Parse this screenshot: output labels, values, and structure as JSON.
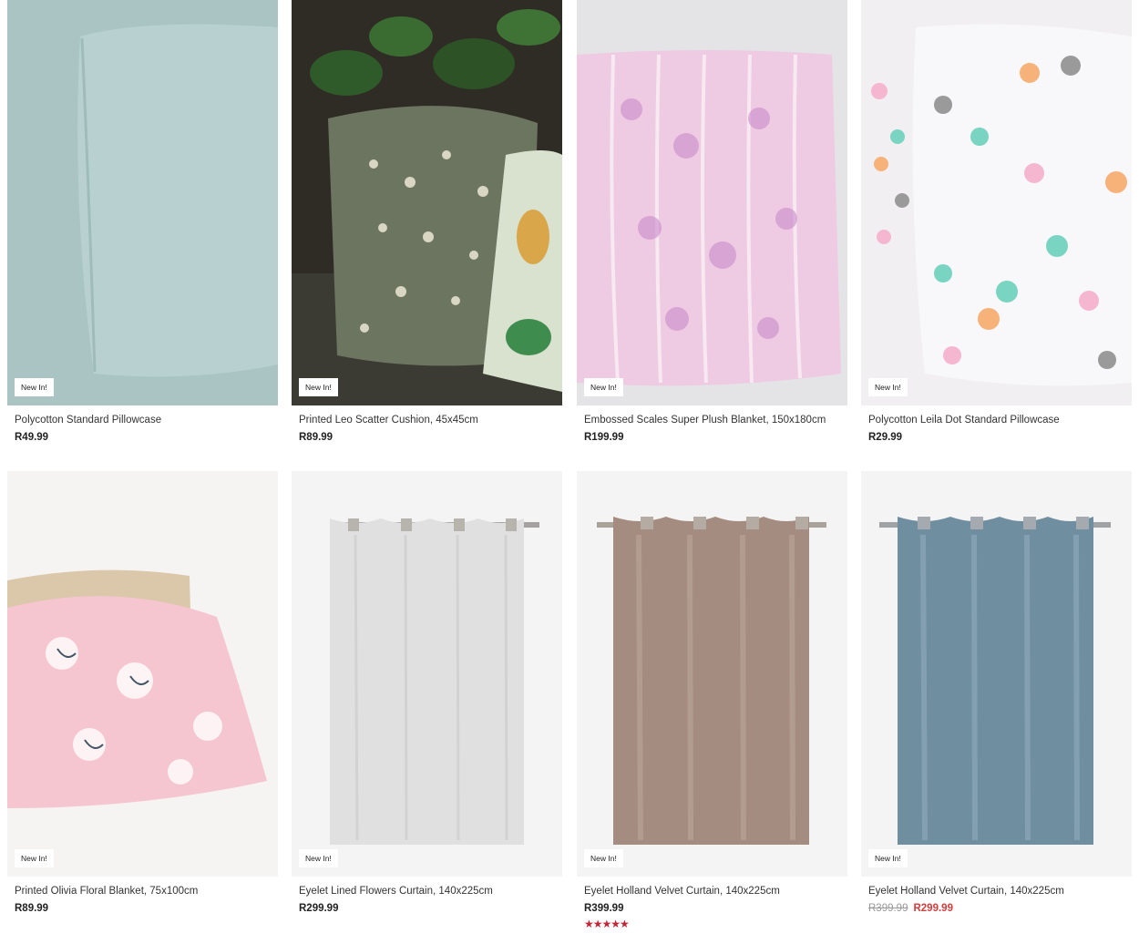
{
  "products": [
    {
      "title": "Polycotton Standard Pillowcase",
      "price": "R49.99",
      "badge": "New In!"
    },
    {
      "title": "Printed Leo Scatter Cushion, 45x45cm",
      "price": "R89.99",
      "badge": "New In!"
    },
    {
      "title": "Embossed Scales Super Plush Blanket, 150x180cm",
      "price": "R199.99",
      "badge": "New In!"
    },
    {
      "title": "Polycotton Leila Dot Standard Pillowcase",
      "price": "R29.99",
      "badge": "New In!"
    },
    {
      "title": "Printed Olivia Floral Blanket, 75x100cm",
      "price": "R89.99",
      "badge": "New In!"
    },
    {
      "title": "Eyelet Lined Flowers Curtain, 140x225cm",
      "price": "R299.99",
      "badge": "New In!"
    },
    {
      "title": "Eyelet Holland Velvet Curtain, 140x225cm",
      "price": "R399.99",
      "badge": "New In!",
      "rating": 5,
      "stars": "★★★★★"
    },
    {
      "title": "Eyelet Holland Velvet Curtain, 140x225cm",
      "was_price": "R399.99",
      "sale_price": "R299.99",
      "badge": "New In!"
    }
  ],
  "colors": {
    "sale": "#d23c3c",
    "rating": "#c0283a"
  }
}
